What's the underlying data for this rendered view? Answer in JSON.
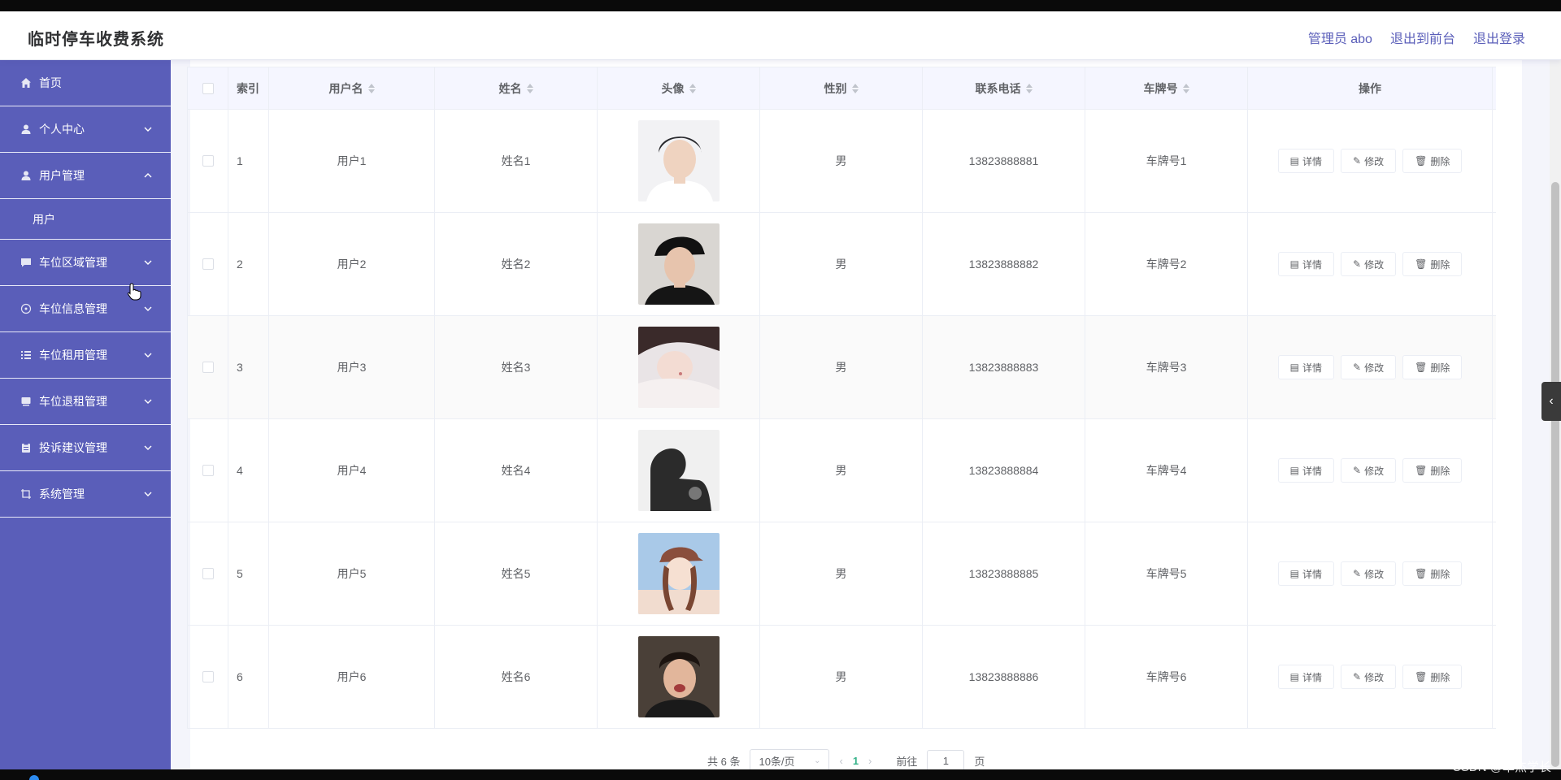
{
  "header": {
    "title": "临时停车收费系统",
    "links": [
      "管理员 abo",
      "退出到前台",
      "退出登录"
    ]
  },
  "sidebar": {
    "items": [
      {
        "label": "首页",
        "icon": "home-icon",
        "expanded": null
      },
      {
        "label": "个人中心",
        "icon": "user-icon",
        "expanded": false
      },
      {
        "label": "用户管理",
        "icon": "user-icon",
        "expanded": true,
        "children": [
          "用户"
        ]
      },
      {
        "label": "车位区域管理",
        "icon": "message-icon",
        "expanded": false
      },
      {
        "label": "车位信息管理",
        "icon": "compass-icon",
        "expanded": false
      },
      {
        "label": "车位租用管理",
        "icon": "list-icon",
        "expanded": false
      },
      {
        "label": "车位退租管理",
        "icon": "box-icon",
        "expanded": false
      },
      {
        "label": "投诉建议管理",
        "icon": "clipboard-icon",
        "expanded": false
      },
      {
        "label": "系统管理",
        "icon": "crop-icon",
        "expanded": false
      }
    ]
  },
  "table": {
    "columns": {
      "index": "索引",
      "username": "用户名",
      "name": "姓名",
      "avatar": "头像",
      "gender": "性别",
      "phone": "联系电话",
      "plate": "车牌号",
      "ops": "操作"
    },
    "rows": [
      {
        "index": "1",
        "username": "用户1",
        "name": "姓名1",
        "gender": "男",
        "phone": "13823888881",
        "plate": "车牌号1"
      },
      {
        "index": "2",
        "username": "用户2",
        "name": "姓名2",
        "gender": "男",
        "phone": "13823888882",
        "plate": "车牌号2"
      },
      {
        "index": "3",
        "username": "用户3",
        "name": "姓名3",
        "gender": "男",
        "phone": "13823888883",
        "plate": "车牌号3"
      },
      {
        "index": "4",
        "username": "用户4",
        "name": "姓名4",
        "gender": "男",
        "phone": "13823888884",
        "plate": "车牌号4"
      },
      {
        "index": "5",
        "username": "用户5",
        "name": "姓名5",
        "gender": "男",
        "phone": "13823888885",
        "plate": "车牌号5"
      },
      {
        "index": "6",
        "username": "用户6",
        "name": "姓名6",
        "gender": "男",
        "phone": "13823888886",
        "plate": "车牌号6"
      }
    ],
    "row_actions": {
      "detail": "详情",
      "edit": "修改",
      "delete": "删除"
    }
  },
  "pagination": {
    "total": "共 6 条",
    "page_size": "10条/页",
    "current_page": "1",
    "goto_prefix": "前往",
    "goto_value": "1",
    "goto_suffix": "页"
  },
  "watermark": "CSDN @卓杰学长",
  "colors": {
    "sidebar": "#5a5eb9",
    "accent": "#5a5eb9",
    "page_active": "#36b38a"
  }
}
